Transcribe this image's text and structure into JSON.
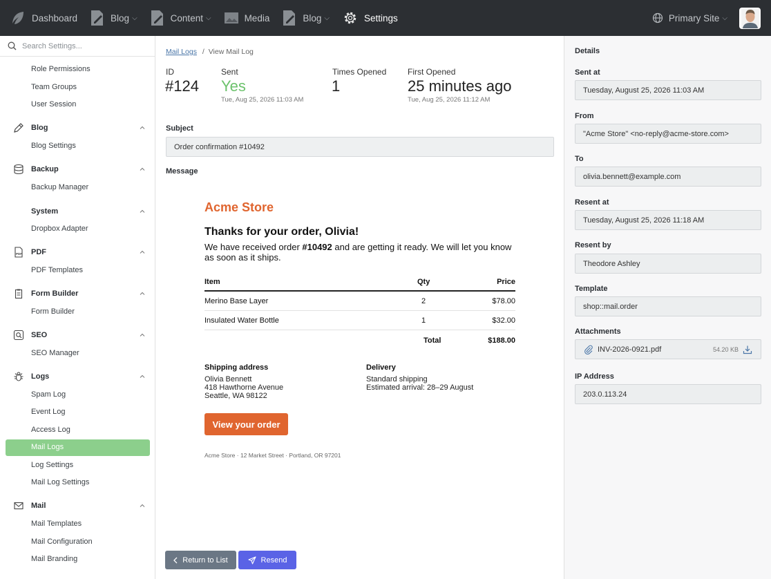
{
  "topnav": {
    "items": [
      {
        "label": "Dashboard",
        "icon": "feather-logo-icon"
      },
      {
        "label": "Blog",
        "icon": "document-pen-icon",
        "dropdown": true
      },
      {
        "label": "Content",
        "icon": "document-pen-icon",
        "dropdown": true
      },
      {
        "label": "Media",
        "icon": "image-icon"
      },
      {
        "label": "Blog",
        "icon": "document-pen-icon",
        "dropdown": true
      },
      {
        "label": "Settings",
        "icon": "gear-icon",
        "active": true
      }
    ],
    "site_label": "Primary Site"
  },
  "sidebar": {
    "search_placeholder": "Search Settings...",
    "top_links": [
      "Role Permissions",
      "Team Groups",
      "User Session"
    ],
    "groups": [
      {
        "label": "Blog",
        "icon": "pencil-icon",
        "items": [
          "Blog Settings"
        ]
      },
      {
        "label": "Backup",
        "icon": "database-icon",
        "items": [
          "Backup Manager"
        ]
      },
      {
        "label": "System",
        "icon": "",
        "items": [
          "Dropbox Adapter"
        ]
      },
      {
        "label": "PDF",
        "icon": "pdf-file-icon",
        "items": [
          "PDF Templates"
        ]
      },
      {
        "label": "Form Builder",
        "icon": "clipboard-icon",
        "items": [
          "Form Builder"
        ]
      },
      {
        "label": "SEO",
        "icon": "seo-icon",
        "items": [
          "SEO Manager"
        ]
      },
      {
        "label": "Logs",
        "icon": "bug-icon",
        "items": [
          "Spam Log",
          "Event Log",
          "Access Log",
          "Mail Logs",
          "Log Settings",
          "Mail Log Settings"
        ]
      },
      {
        "label": "Mail",
        "icon": "envelope-icon",
        "items": [
          "Mail Templates",
          "Mail Configuration",
          "Mail Branding"
        ]
      }
    ],
    "active_item": "Mail Logs"
  },
  "breadcrumb": {
    "link": "Mail Logs",
    "separator": "/",
    "current": "View Mail Log"
  },
  "stats": {
    "id_label": "ID",
    "id_value": "#124",
    "sent_label": "Sent",
    "sent_value": "Yes",
    "sent_sub": "Tue, Aug 25, 2026 11:03 AM",
    "opened_label": "Times Opened",
    "opened_value": "1",
    "first_label": "First Opened",
    "first_value": "25 minutes ago",
    "first_sub": "Tue, Aug 25, 2026 11:12 AM"
  },
  "subject": {
    "label": "Subject",
    "value": "Order confirmation #10492"
  },
  "message_label": "Message",
  "email": {
    "brand": "Acme Store",
    "heading": "Thanks for your order, Olivia!",
    "body_pre": "We have received order ",
    "order_no": "#10492",
    "body_post": " and are getting it ready. We will let you know as soon as it ships.",
    "table_headers": {
      "item": "Item",
      "qty": "Qty",
      "price": "Price"
    },
    "rows": [
      {
        "item": "Merino Base Layer",
        "qty": "2",
        "price": "$78.00"
      },
      {
        "item": "Insulated Water Bottle",
        "qty": "1",
        "price": "$32.00"
      }
    ],
    "total_label": "Total",
    "total_value": "$188.00",
    "shipping_heading": "Shipping address",
    "shipping_lines": [
      "Olivia Bennett",
      "418 Hawthorne Avenue",
      "Seattle, WA 98122"
    ],
    "delivery_heading": "Delivery",
    "delivery_lines": [
      "Standard shipping",
      "Estimated arrival: 28–29 August"
    ],
    "cta": "View your order",
    "footer": "Acme Store · 12 Market Street · Portland, OR 97201"
  },
  "buttons": {
    "return": "Return to List",
    "resend": "Resend"
  },
  "details": {
    "heading": "Details",
    "fields": [
      {
        "label": "Sent at",
        "value": "Tuesday, August 25, 2026 11:03 AM"
      },
      {
        "label": "From",
        "value": "\"Acme Store\" <no-reply@acme-store.com>"
      },
      {
        "label": "To",
        "value": "olivia.bennett@example.com"
      },
      {
        "label": "Resent at",
        "value": "Tuesday, August 25, 2026 11:18 AM"
      },
      {
        "label": "Resent by",
        "value": "Theodore Ashley"
      },
      {
        "label": "Template",
        "value": "shop::mail.order"
      }
    ],
    "attachments_label": "Attachments",
    "attachment": {
      "name": "INV-2026-0921.pdf",
      "size": "54.20 KB"
    },
    "ip_label": "IP Address",
    "ip_value": "203.0.113.24"
  },
  "colors": {
    "accent_green": "#8ccf8c",
    "brand_orange": "#e0652f",
    "resend_blue": "#5a63e6",
    "nav_bg": "#2c2f33"
  }
}
